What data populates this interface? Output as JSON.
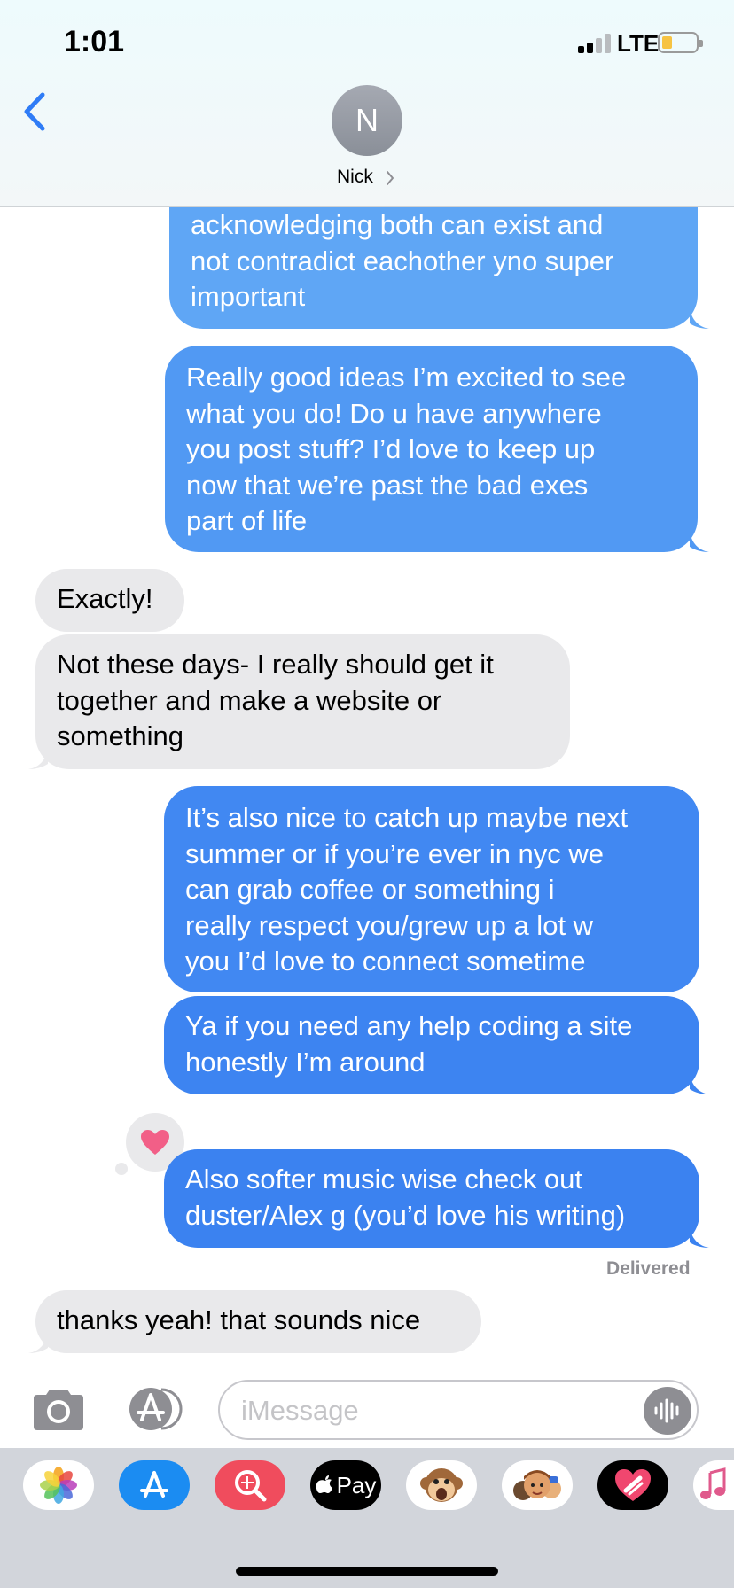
{
  "status_bar": {
    "time": "1:01",
    "network": "LTE",
    "battery_color": "#f6c343"
  },
  "header": {
    "avatar_initial": "N",
    "contact_name": "Nick",
    "back_icon": "chevron-left-icon",
    "accent_color": "#2f7cf6"
  },
  "messages": [
    {
      "from": "me",
      "text": "acknowledging both can exist and\nnot contradict eachother yno super\nimportant"
    },
    {
      "from": "me",
      "text": "Really good ideas I’m excited to see\nwhat you do! Do u have anywhere\nyou post stuff? I’d love to keep up\nnow that we’re past the bad exes\npart of life"
    },
    {
      "from": "them",
      "text": "Exactly!"
    },
    {
      "from": "them",
      "text": "Not these days- I really should get it\ntogether and make a website or\nsomething"
    },
    {
      "from": "me",
      "text": "It’s also nice to catch up maybe next\nsummer or if you’re ever in nyc we\ncan grab coffee or something i\nreally respect you/grew up a lot w\nyou I’d love to connect sometime"
    },
    {
      "from": "me",
      "text": "Ya if you need any help coding a site\nhonestly I’m around"
    },
    {
      "from": "me",
      "text": "Also softer music wise check out\nduster/Alex g (you’d love his writing)",
      "reaction": "heart-icon"
    },
    {
      "from": "them",
      "text": "thanks yeah! that sounds nice"
    }
  ],
  "delivered_label": "Delivered",
  "composer": {
    "placeholder": "iMessage",
    "value": ""
  },
  "app_drawer": {
    "apps": [
      {
        "icon": "photos-app-icon"
      },
      {
        "icon": "app-store-icon"
      },
      {
        "icon": "image-search-icon"
      },
      {
        "icon": "apple-pay-icon",
        "label": "Pay"
      },
      {
        "icon": "animoji-monkey-icon"
      },
      {
        "icon": "memoji-icon"
      },
      {
        "icon": "digital-touch-icon"
      },
      {
        "icon": "music-icon"
      }
    ]
  }
}
